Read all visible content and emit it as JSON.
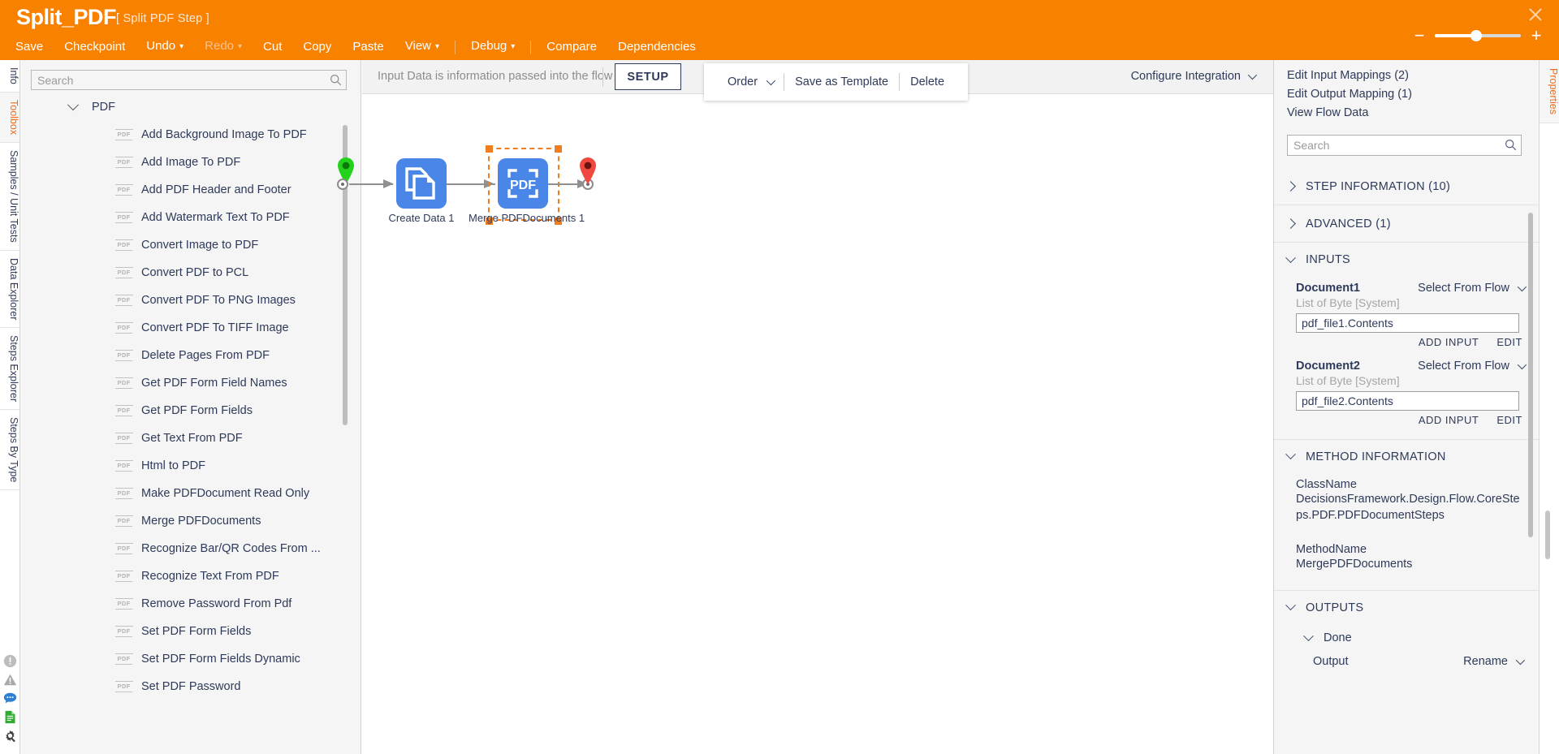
{
  "header": {
    "title": "Split_PDF",
    "subtitle": "[ Split PDF Step ]",
    "close_icon": "close-icon",
    "menu": [
      {
        "label": "Save",
        "caret": false,
        "disabled": false
      },
      {
        "label": "Checkpoint",
        "caret": false,
        "disabled": false
      },
      {
        "label": "Undo",
        "caret": true,
        "disabled": false
      },
      {
        "label": "Redo",
        "caret": true,
        "disabled": true
      },
      {
        "label": "Cut",
        "caret": false,
        "disabled": false
      },
      {
        "label": "Copy",
        "caret": false,
        "disabled": false
      },
      {
        "label": "Paste",
        "caret": false,
        "disabled": false
      },
      {
        "label": "View",
        "caret": true,
        "disabled": false
      },
      {
        "label": "Debug",
        "caret": true,
        "disabled": false
      },
      {
        "label": "Compare",
        "caret": false,
        "disabled": false
      },
      {
        "label": "Dependencies",
        "caret": false,
        "disabled": false
      }
    ],
    "zoom": {
      "minus": "−",
      "plus": "+",
      "value": 45
    }
  },
  "left_tabs": [
    {
      "label": "Info",
      "active": false
    },
    {
      "label": "Toolbox",
      "active": true
    },
    {
      "label": "Samples / Unit Tests",
      "active": false
    },
    {
      "label": "Data Explorer",
      "active": false
    },
    {
      "label": "Steps Explorer",
      "active": false
    },
    {
      "label": "Steps By Type",
      "active": false
    }
  ],
  "left_status_icons": [
    {
      "name": "info-icon",
      "color": "#b9b9b9"
    },
    {
      "name": "warning-icon",
      "color": "#a8a8a8"
    },
    {
      "name": "chat-icon",
      "color": "#2d7fd4"
    },
    {
      "name": "document-icon",
      "color": "#33aa33"
    },
    {
      "name": "gear-wrench-icon",
      "color": "#3c3c3c"
    }
  ],
  "toolbox": {
    "search_placeholder": "Search",
    "search_value": "",
    "search_icon": "search-icon",
    "group_label": "PDF",
    "items": [
      "Add Background Image To PDF",
      "Add Image To PDF",
      "Add PDF Header and Footer",
      "Add Watermark Text To PDF",
      "Convert Image to PDF",
      "Convert PDF to PCL",
      "Convert PDF To PNG Images",
      "Convert PDF To TIFF Image",
      "Delete Pages From PDF",
      "Get PDF Form Field Names",
      "Get PDF Form Fields",
      "Get Text From PDF",
      "Html to PDF",
      "Make PDFDocument Read Only",
      "Merge PDFDocuments",
      "Recognize Bar/QR Codes From ...",
      "Recognize Text From PDF",
      "Remove Password From Pdf",
      "Set PDF Form Fields",
      "Set PDF Form Fields Dynamic",
      "Set PDF Password"
    ],
    "item_icon": "pdf-file-icon",
    "item_icon_text": "PDF"
  },
  "center": {
    "hint": "Input Data is information passed into the flow",
    "setup_button": "SETUP",
    "configure_integration": "Configure Integration",
    "popup_menu": [
      {
        "label": "Order",
        "caret": true
      },
      {
        "label": "Save as Template",
        "caret": false
      },
      {
        "label": "Delete",
        "caret": false
      }
    ],
    "nodes": [
      {
        "label": "Create Data 1",
        "icon": "copy-documents-icon",
        "selected": false
      },
      {
        "label": "Merge PDFDocuments 1",
        "icon": "pdf-scan-icon",
        "selected": true
      }
    ],
    "start_marker": "start-pin-icon",
    "end_marker": "end-pin-icon"
  },
  "properties": {
    "links": [
      "Edit Input Mappings (2)",
      "Edit Output Mapping (1)",
      "View Flow Data"
    ],
    "search_placeholder": "Search",
    "search_value": "",
    "search_icon": "search-icon",
    "sections": [
      {
        "label": "STEP INFORMATION (10)",
        "expanded": false
      },
      {
        "label": "ADVANCED (1)",
        "expanded": false
      },
      {
        "label": "INPUTS",
        "expanded": true
      },
      {
        "label": "METHOD INFORMATION",
        "expanded": true
      },
      {
        "label": "OUTPUTS",
        "expanded": true
      }
    ],
    "inputs": [
      {
        "name": "Document1",
        "selector": "Select From Flow",
        "type": "List of Byte [System]",
        "value": "pdf_file1.Contents",
        "add_label": "ADD INPUT",
        "edit_label": "EDIT"
      },
      {
        "name": "Document2",
        "selector": "Select From Flow",
        "type": "List of Byte [System]",
        "value": "pdf_file2.Contents",
        "add_label": "ADD INPUT",
        "edit_label": "EDIT"
      }
    ],
    "method_information": {
      "class_label": "ClassName",
      "class_value": "DecisionsFramework.Design.Flow.CoreSteps.PDF.PDFDocumentSteps",
      "method_label": "MethodName",
      "method_value": "MergePDFDocuments"
    },
    "outputs": {
      "branch": "Done",
      "row_label": "Output",
      "row_action": "Rename"
    }
  },
  "right_tab": "Properties",
  "colors": {
    "brand_orange": "#f98100",
    "accent_orange": "#f46a16",
    "node_blue": "#4a86e8",
    "text_navy": "#2e3a59",
    "start_green": "#23d21a",
    "end_red": "#f0473e"
  }
}
